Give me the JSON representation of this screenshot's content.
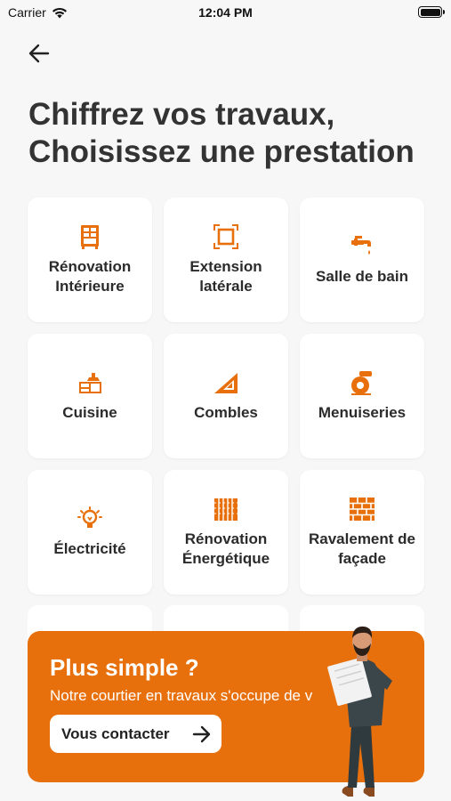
{
  "status_bar": {
    "carrier": "Carrier",
    "time": "12:04 PM",
    "battery": 1.0
  },
  "header": {
    "title_line1": "Chiffrez vos travaux,",
    "title_line2": "Choisissez une prestation"
  },
  "services": [
    {
      "label": "Rénovation Intérieure",
      "icon": "cabinet-icon"
    },
    {
      "label": "Extension latérale",
      "icon": "expand-square-icon"
    },
    {
      "label": "Salle de bain",
      "icon": "faucet-icon"
    },
    {
      "label": "Cuisine",
      "icon": "kitchen-icon"
    },
    {
      "label": "Combles",
      "icon": "attic-roof-icon"
    },
    {
      "label": "Menuiseries",
      "icon": "saw-icon"
    },
    {
      "label": "Électricité",
      "icon": "lightbulb-icon"
    },
    {
      "label": "Rénovation Énergétique",
      "icon": "insulation-icon"
    },
    {
      "label": "Ravalement de façade",
      "icon": "brick-wall-icon"
    }
  ],
  "promo": {
    "title": "Plus simple ?",
    "text": "Notre courtier en travaux s'occupe de v",
    "button_label": "Vous contacter"
  },
  "colors": {
    "accent": "#e8700c",
    "background": "#f7f7f7",
    "card": "#ffffff",
    "text": "#2b2b2b"
  }
}
